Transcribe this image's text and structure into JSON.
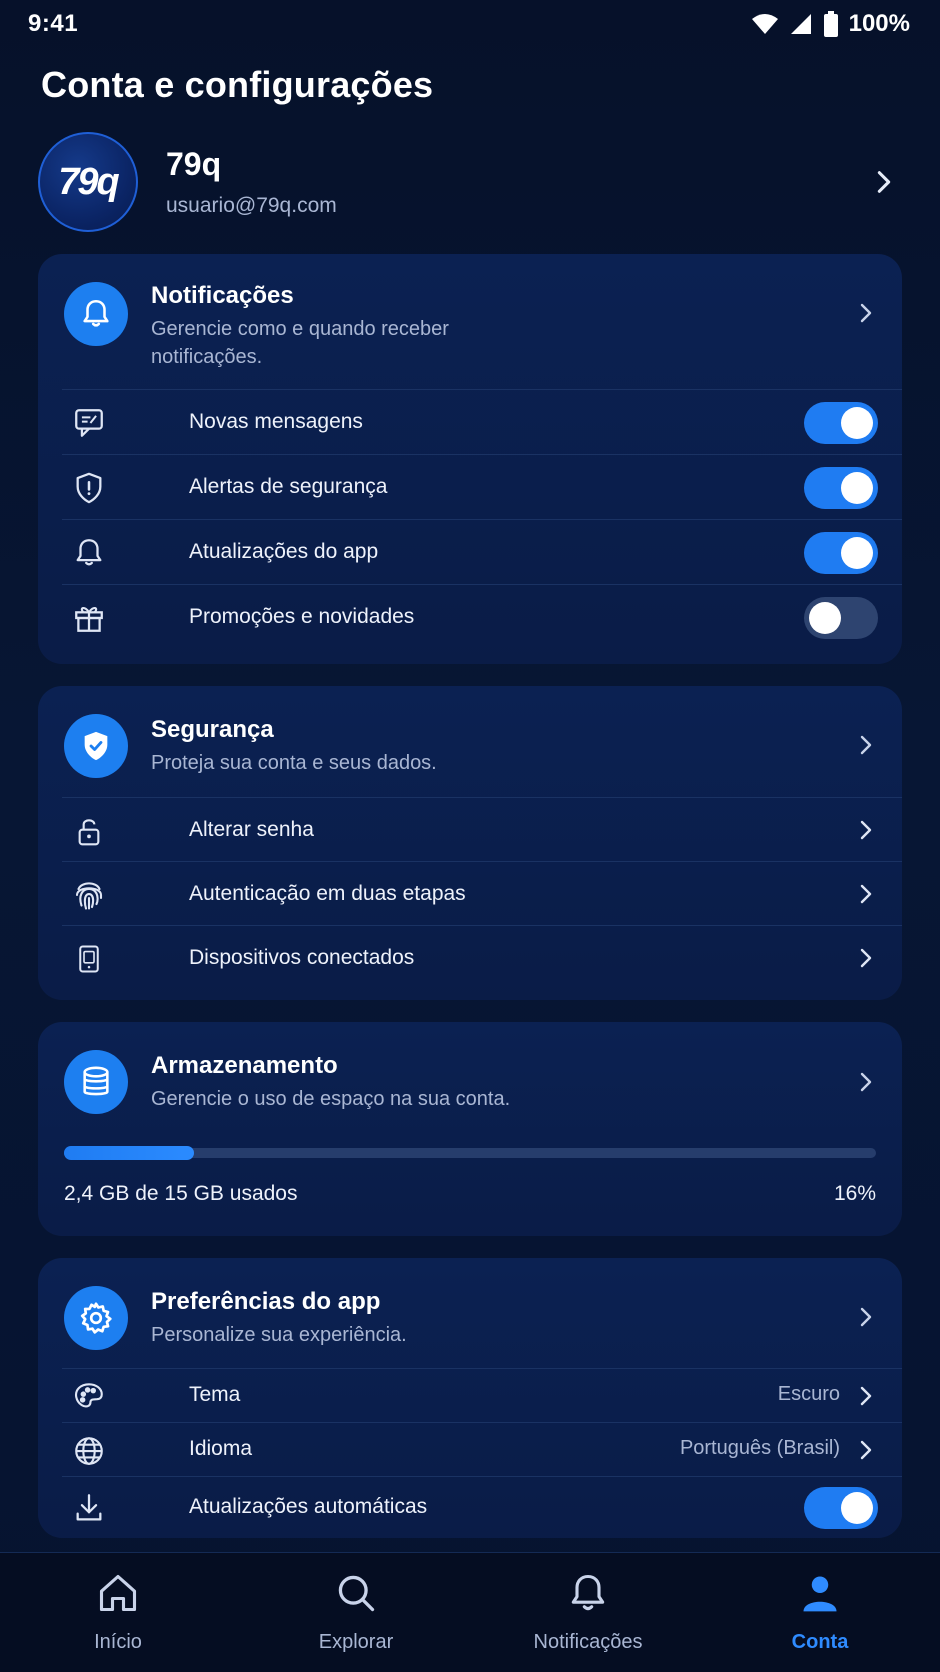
{
  "status_bar": {
    "time": "9:41",
    "battery": "100%"
  },
  "page": {
    "title": "Conta e configurações"
  },
  "profile": {
    "avatar_text": "79q",
    "name": "79q",
    "email": "usuario@79q.com"
  },
  "notifications": {
    "title": "Notificações",
    "subtitle_line1": "Gerencie como e quando receber",
    "subtitle_line2": "notificações.",
    "items": [
      {
        "label": "Novas mensagens",
        "icon": "message-icon",
        "enabled": true
      },
      {
        "label": "Alertas de segurança",
        "icon": "shield-alert-icon",
        "enabled": true
      },
      {
        "label": "Atualizações do app",
        "icon": "bell-icon",
        "enabled": true
      },
      {
        "label": "Promoções e novidades",
        "icon": "gift-icon",
        "enabled": false
      }
    ]
  },
  "security": {
    "title": "Segurança",
    "subtitle": "Proteja sua conta e seus dados.",
    "items": [
      {
        "label": "Alterar senha",
        "icon": "lock-icon"
      },
      {
        "label": "Autenticação em duas etapas",
        "icon": "fingerprint-icon"
      },
      {
        "label": "Dispositivos conectados",
        "icon": "phone-device-icon"
      }
    ]
  },
  "storage": {
    "title": "Armazenamento",
    "subtitle": "Gerencie o uso de espaço na sua conta.",
    "used_text": "2,4 GB de 15 GB usados",
    "percent_text": "16%",
    "used_fraction": 0.16
  },
  "preferences": {
    "title": "Preferências do app",
    "subtitle": "Personalize sua experiência.",
    "theme_label": "Tema",
    "theme_value": "Escuro",
    "language_label": "Idioma",
    "language_value": "Português (Brasil)",
    "auto_update_label": "Atualizações automáticas",
    "auto_update_enabled": true
  },
  "bottom_nav": {
    "items": [
      {
        "label": "Início",
        "icon": "home-icon"
      },
      {
        "label": "Explorar",
        "icon": "search-icon"
      },
      {
        "label": "Notificações",
        "icon": "bell-icon"
      },
      {
        "label": "Conta",
        "icon": "user-icon",
        "active": true
      }
    ]
  },
  "colors": {
    "accent": "#1f7cf2",
    "background": "#06112a",
    "card": "#0b2152",
    "muted_text": "#a9b6d3"
  }
}
